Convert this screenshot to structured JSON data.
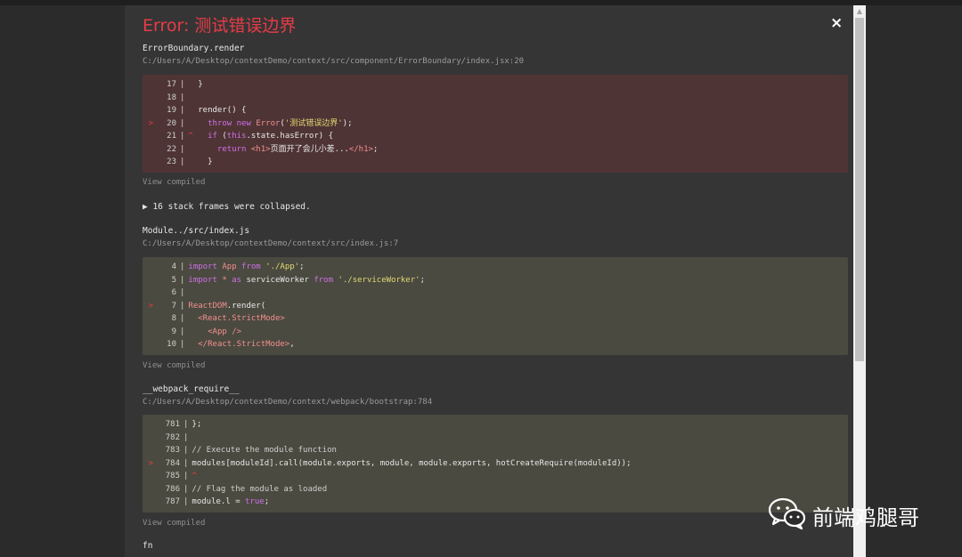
{
  "error": {
    "title": "Error: 测试错误边界",
    "close_label": "×"
  },
  "frames": [
    {
      "name": "ErrorBoundary.render",
      "path": "C:/Users/A/Desktop/contextDemo/context/src/component/ErrorBoundary/index.jsx:20",
      "view_label": "View compiled"
    },
    {
      "name": "Module../src/index.js",
      "path": "C:/Users/A/Desktop/contextDemo/context/src/index.js:7",
      "view_label": "View compiled"
    },
    {
      "name": "__webpack_require__",
      "path": "C:/Users/A/Desktop/contextDemo/context/webpack/bootstrap:784",
      "view_label": "View compiled"
    },
    {
      "name": "fn"
    }
  ],
  "collapsed_label": "▶ 16 stack frames were collapsed.",
  "watermark": {
    "text": "前端鸡腿哥"
  },
  "colors": {
    "error_red": "#e83b46",
    "overlay_bg": "#353535",
    "error_code_bg": "#4f3435",
    "code_bg": "#4a4a40"
  }
}
